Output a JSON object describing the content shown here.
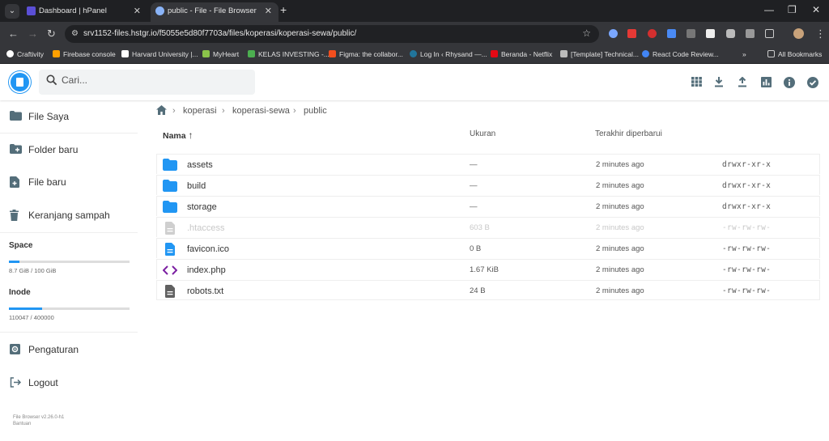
{
  "browser": {
    "tabs": [
      {
        "title": "Dashboard | hPanel",
        "active": false
      },
      {
        "title": "public - File - File Browser",
        "active": true
      }
    ],
    "url": "srv1152-files.hstgr.io/f5055e5d80f7703a/files/koperasi/koperasi-sewa/public/",
    "bookmarks": [
      "Craftivity",
      "Firebase console",
      "Harvard University |...",
      "MyHeart",
      "KELAS INVESTING -...",
      "Figma: the collabor...",
      "Log In ‹ Rhysand —...",
      "Beranda - Netflix",
      "[Template] Technical...",
      "React Code Review...",
      "All Bookmarks"
    ]
  },
  "header": {
    "search_placeholder": "Cari...",
    "icons": [
      "grid-view-icon",
      "download-icon",
      "upload-icon",
      "chart-icon",
      "info-icon",
      "check-circle-icon"
    ]
  },
  "sidebar": {
    "items": [
      {
        "label": "File Saya",
        "icon": "folder-icon"
      },
      {
        "label": "Folder baru",
        "icon": "folder-add-icon"
      },
      {
        "label": "File baru",
        "icon": "file-add-icon"
      },
      {
        "label": "Keranjang sampah",
        "icon": "trash-icon"
      }
    ],
    "space": {
      "label": "Space",
      "usage": "8.7 GiB / 100 GiB",
      "fraction": 0.087
    },
    "inode": {
      "label": "Inode",
      "usage": "110047 / 400000",
      "fraction": 0.275
    },
    "settings": "Pengaturan",
    "logout": "Logout",
    "version": "File Browser v2.26.0-h1",
    "help": "Bantuan"
  },
  "breadcrumb": [
    "koperasi",
    "koperasi-sewa",
    "public"
  ],
  "listing": {
    "columns": {
      "name": "Nama",
      "size": "Ukuran",
      "modified": "Terakhir diperbarui"
    },
    "rows": [
      {
        "name": "assets",
        "size": "—",
        "modified": "2 minutes ago",
        "perm": "drwxr-xr-x",
        "type": "folder"
      },
      {
        "name": "build",
        "size": "—",
        "modified": "2 minutes ago",
        "perm": "drwxr-xr-x",
        "type": "folder"
      },
      {
        "name": "storage",
        "size": "—",
        "modified": "2 minutes ago",
        "perm": "drwxr-xr-x",
        "type": "folder"
      },
      {
        "name": ".htaccess",
        "size": "603 B",
        "modified": "2 minutes ago",
        "perm": "-rw-rw-rw-",
        "type": "hidden"
      },
      {
        "name": "favicon.ico",
        "size": "0 B",
        "modified": "2 minutes ago",
        "perm": "-rw-rw-rw-",
        "type": "image"
      },
      {
        "name": "index.php",
        "size": "1.67 KiB",
        "modified": "2 minutes ago",
        "perm": "-rw-rw-rw-",
        "type": "code"
      },
      {
        "name": "robots.txt",
        "size": "24 B",
        "modified": "2 minutes ago",
        "perm": "-rw-rw-rw-",
        "type": "text"
      }
    ]
  },
  "colors": {
    "accent": "#2196f3",
    "icon": "#546e7a"
  }
}
